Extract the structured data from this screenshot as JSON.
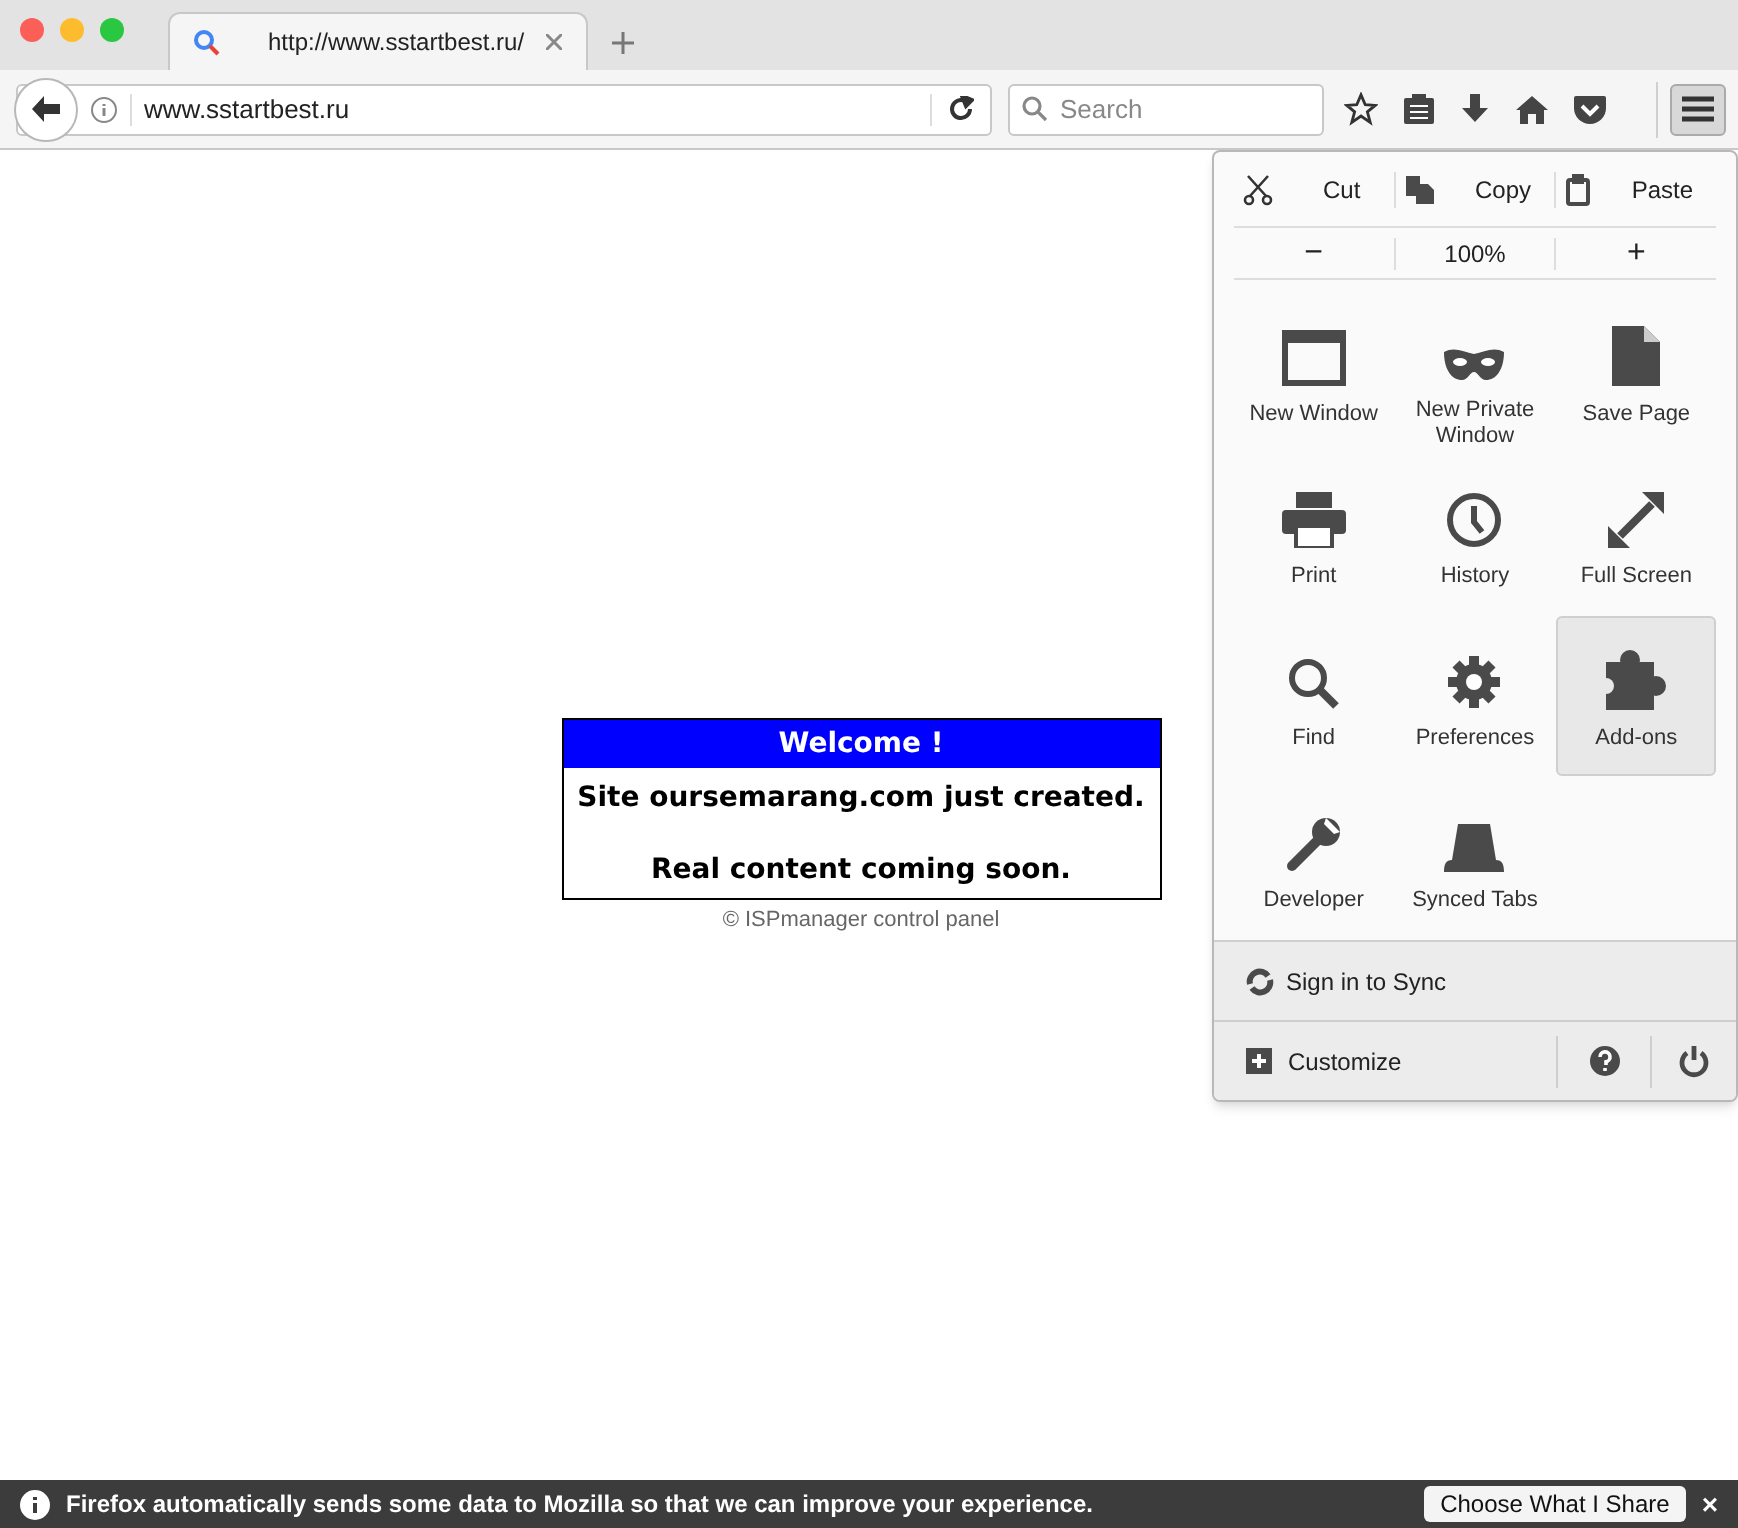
{
  "tab": {
    "title": "http://www.sstartbest.ru/"
  },
  "toolbar": {
    "url": "www.sstartbest.ru",
    "search_placeholder": "Search"
  },
  "page": {
    "heading": "Welcome !",
    "line_1": "Site oursemarang.com just created.",
    "line_2": "Real content coming soon.",
    "footer": "© ISPmanager control panel"
  },
  "menu": {
    "edit": [
      {
        "kind": "cut",
        "label": "Cut"
      },
      {
        "kind": "copy",
        "label": "Copy"
      },
      {
        "kind": "paste",
        "label": "Paste"
      }
    ],
    "zoom": {
      "minus": "−",
      "level": "100%",
      "plus": "+"
    },
    "items": [
      {
        "kind": "window",
        "label": "New Window",
        "selected": false
      },
      {
        "kind": "mask",
        "label": "New Private Window",
        "selected": false
      },
      {
        "kind": "page",
        "label": "Save Page",
        "selected": false
      },
      {
        "kind": "print",
        "label": "Print",
        "selected": false
      },
      {
        "kind": "clock",
        "label": "History",
        "selected": false
      },
      {
        "kind": "expand",
        "label": "Full Screen",
        "selected": false
      },
      {
        "kind": "find",
        "label": "Find",
        "selected": false
      },
      {
        "kind": "gear",
        "label": "Preferences",
        "selected": false
      },
      {
        "kind": "puzzle",
        "label": "Add-ons",
        "selected": true
      },
      {
        "kind": "wrench",
        "label": "Developer",
        "selected": false
      },
      {
        "kind": "synced",
        "label": "Synced Tabs",
        "selected": false
      }
    ],
    "sync": "Sign in to Sync",
    "customize": "Customize"
  },
  "notification": {
    "message": "Firefox automatically sends some data to Mozilla so that we can improve your experience.",
    "button": "Choose What I Share",
    "close": "×"
  }
}
